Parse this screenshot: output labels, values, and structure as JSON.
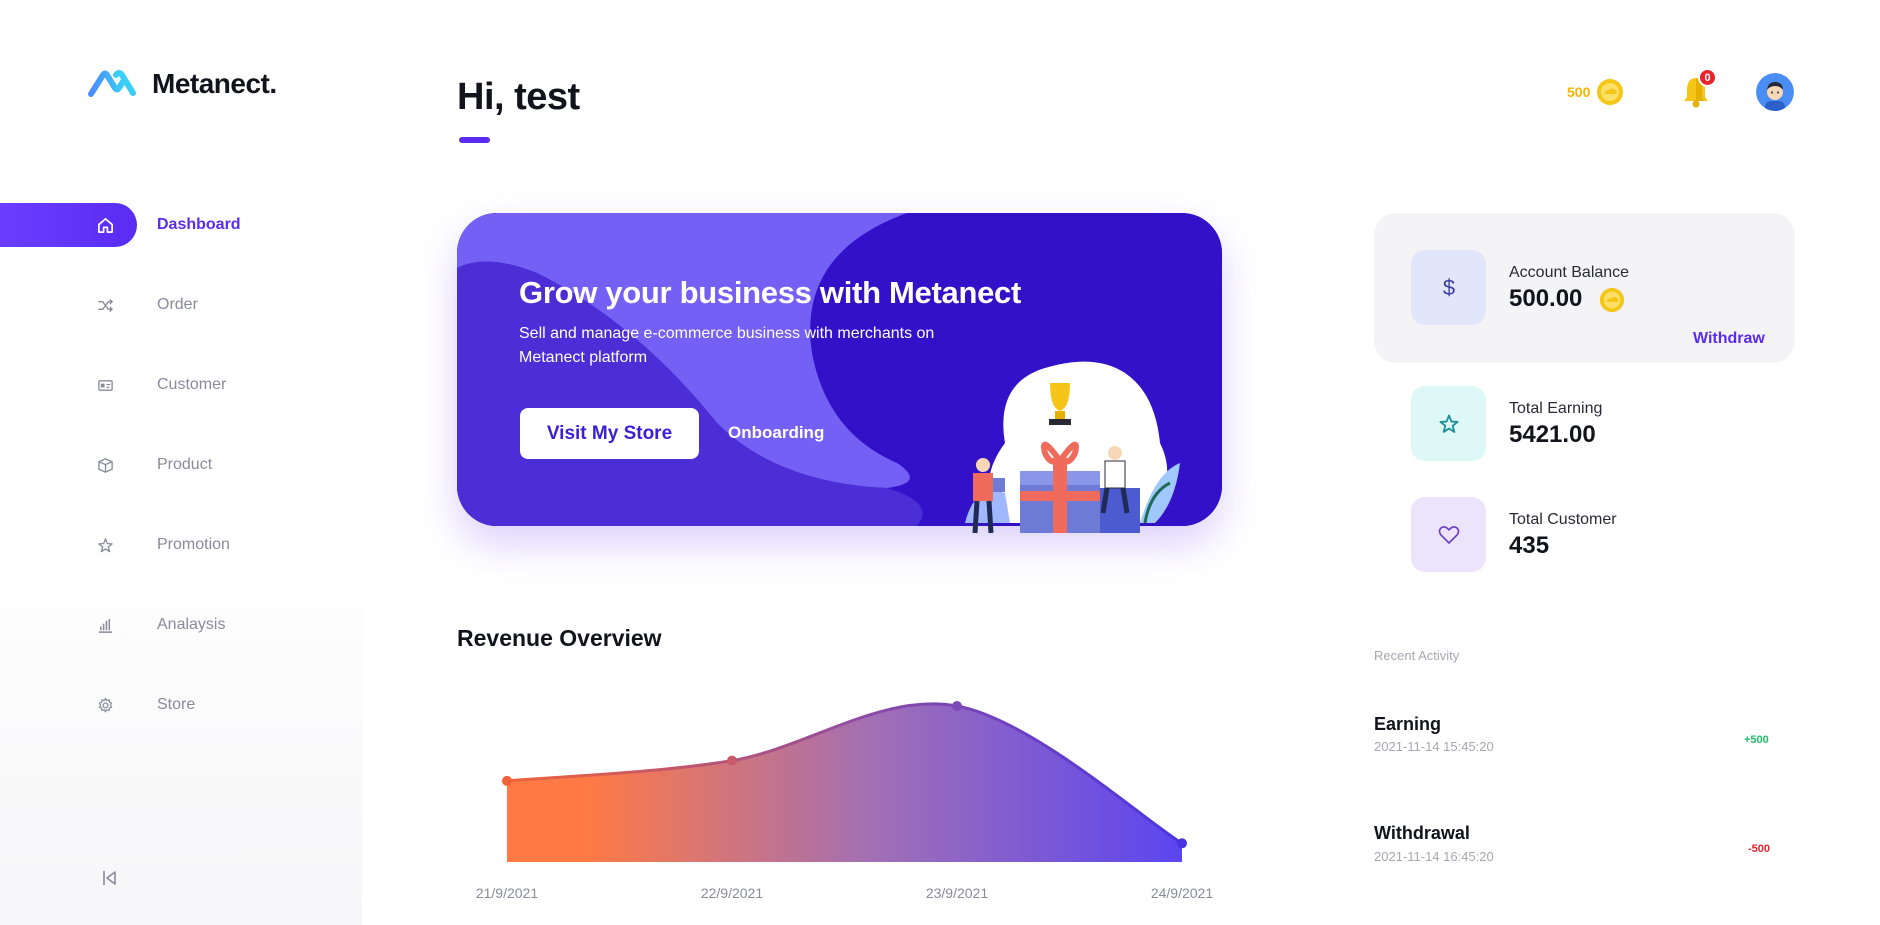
{
  "brand": {
    "name": "Metanect."
  },
  "sidebar": {
    "items": [
      {
        "label": "Dashboard",
        "icon": "home-icon",
        "active": true
      },
      {
        "label": "Order",
        "icon": "shuffle-icon",
        "active": false
      },
      {
        "label": "Customer",
        "icon": "id-card-icon",
        "active": false
      },
      {
        "label": "Product",
        "icon": "box-icon",
        "active": false
      },
      {
        "label": "Promotion",
        "icon": "star-icon",
        "active": false
      },
      {
        "label": "Analaysis",
        "icon": "bar-chart-icon",
        "active": false
      },
      {
        "label": "Store",
        "icon": "gear-icon",
        "active": false
      }
    ],
    "collapse_icon": "collapse-left-icon"
  },
  "header": {
    "greeting": "Hi, test",
    "coins": "500",
    "notifications": "0"
  },
  "banner": {
    "title": "Grow your business with Metanect",
    "subtitle": "Sell and manage e-commerce business with merchants on Metanect platform",
    "primary_button": "Visit My Store",
    "secondary_button": "Onboarding"
  },
  "revenue": {
    "title": "Revenue Overview"
  },
  "chart_data": {
    "type": "area",
    "x": [
      "21/9/2021",
      "22/9/2021",
      "23/9/2021",
      "24/9/2021"
    ],
    "values": [
      0.52,
      0.65,
      1.0,
      0.12
    ],
    "ylim": [
      0,
      1.0
    ],
    "colors": {
      "start": "#ff7a45",
      "end": "#5b45f0"
    }
  },
  "balance": {
    "label": "Account Balance",
    "value": "500.00",
    "action": "Withdraw"
  },
  "stats": [
    {
      "label": "Total Earning",
      "value": "5421.00",
      "icon": "star-icon"
    },
    {
      "label": "Total Customer",
      "value": "435",
      "icon": "heart-icon"
    }
  ],
  "recent": {
    "title": "Recent Activity",
    "items": [
      {
        "title": "Earning",
        "time": "2021-11-14 15:45:20",
        "amount": "+500",
        "color": "#1fbf6a"
      },
      {
        "title": "Withdrawal",
        "time": "2021-11-14 16:45:20",
        "amount": "-500",
        "color": "#e8252c"
      }
    ]
  },
  "colors": {
    "accent": "#5a2cf2",
    "coin": "#f5c518"
  }
}
